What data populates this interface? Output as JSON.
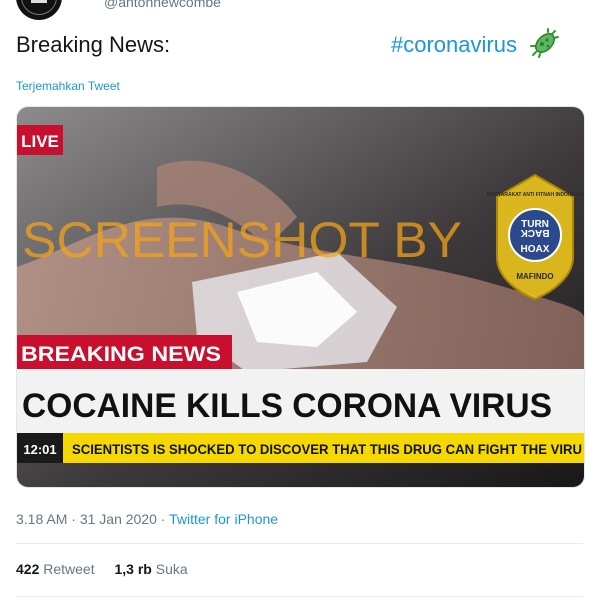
{
  "user": {
    "handle": "@antonnewcombe"
  },
  "tweet": {
    "lead_text": "Breaking News:",
    "hashtag": "#coronavirus",
    "emoji_icon": "microbe-icon",
    "translate_label": "Terjemahkan Tweet"
  },
  "media": {
    "live_badge": "LIVE",
    "watermark": "SCREENSHOT BY",
    "breaking_label": "BREAKING NEWS",
    "headline": "COCAINE KILLS CORONA VIRUS",
    "clock": "12:01",
    "ticker": "SCIENTISTS IS SHOCKED TO DISCOVER THAT THIS DRUG CAN FIGHT THE VIRU",
    "logo_text": [
      "TURN",
      "BACK",
      "HOAX"
    ],
    "logo_ring_text": "MASYARAKAT ANTI FITNAH INDONESIA",
    "logo_bottom": "MAFINDO"
  },
  "meta": {
    "time": "3.18 AM",
    "separator": "·",
    "date": "31 Jan 2020",
    "source": "Twitter for iPhone"
  },
  "stats": {
    "retweets_count": "422",
    "retweets_label": "Retweet",
    "likes_count": "1,3 rb",
    "likes_label": "Suka"
  },
  "colors": {
    "link": "#1b95e0",
    "muted": "#657786",
    "breaking_red": "#c8102e",
    "ticker_yellow": "#f5d800"
  }
}
